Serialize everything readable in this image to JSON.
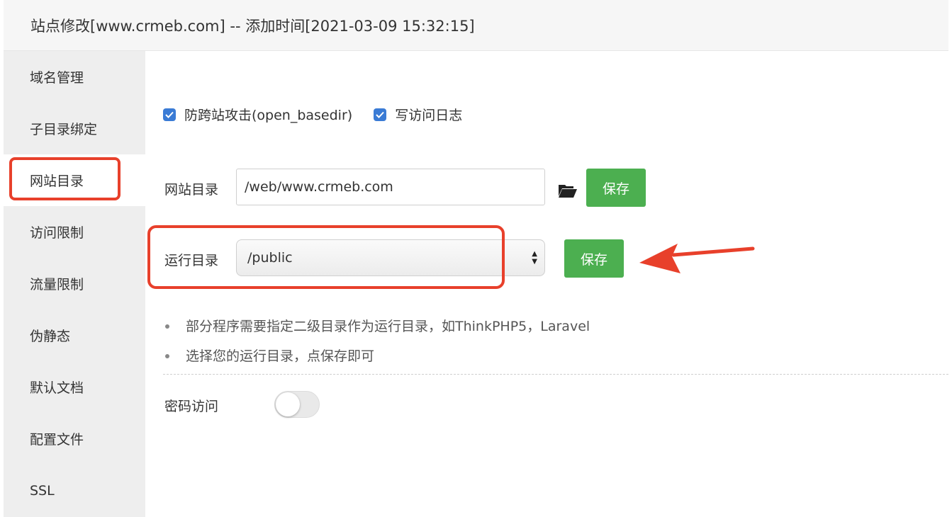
{
  "window": {
    "title": "站点修改[www.crmeb.com] -- 添加时间[2021-03-09 15:32:15]"
  },
  "sidebar": {
    "items": [
      {
        "label": "域名管理"
      },
      {
        "label": "子目录绑定"
      },
      {
        "label": "网站目录"
      },
      {
        "label": "访问限制"
      },
      {
        "label": "流量限制"
      },
      {
        "label": "伪静态"
      },
      {
        "label": "默认文档"
      },
      {
        "label": "配置文件"
      },
      {
        "label": "SSL"
      }
    ],
    "active": "网站目录"
  },
  "options": {
    "anti_xss": {
      "label": "防跨站攻击(open_basedir)",
      "checked": true
    },
    "access_log": {
      "label": "写访问日志",
      "checked": true
    }
  },
  "site_dir": {
    "label": "网站目录",
    "value": "/web/www.crmeb.com",
    "save_label": "保存"
  },
  "run_dir": {
    "label": "运行目录",
    "value": "/public",
    "save_label": "保存"
  },
  "tips": [
    "部分程序需要指定二级目录作为运行目录，如ThinkPHP5，Laravel",
    "选择您的运行目录，点保存即可"
  ],
  "password_access": {
    "label": "密码访问",
    "enabled": false
  },
  "colors": {
    "accent_blue": "#3a7bd5",
    "save_green": "#4caf50",
    "annotation_red": "#e8402b"
  }
}
